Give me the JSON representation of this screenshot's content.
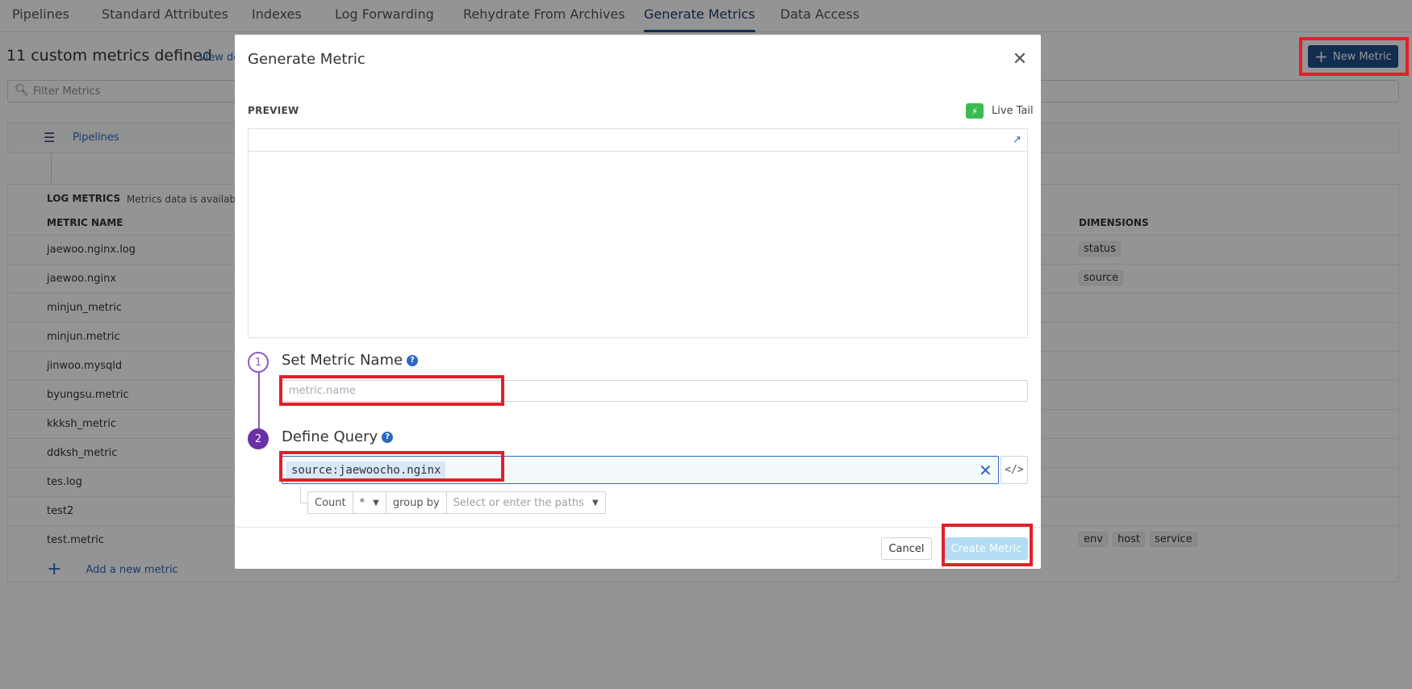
{
  "nav": {
    "tabs": [
      {
        "label": "Pipelines"
      },
      {
        "label": "Standard Attributes"
      },
      {
        "label": "Indexes"
      },
      {
        "label": "Log Forwarding"
      },
      {
        "label": "Rehydrate From Archives"
      },
      {
        "label": "Generate Metrics",
        "active": true
      },
      {
        "label": "Data Access"
      }
    ]
  },
  "page": {
    "count_title": "11 custom metrics defined",
    "view_docs": "View do",
    "new_metric_label": "New Metric",
    "filter_placeholder": "Filter Metrics",
    "pipelines_label": "Pipelines",
    "log_metrics_title": "LOG METRICS",
    "log_metrics_sub": "Metrics data is available f",
    "col_metric_name": "METRIC NAME",
    "col_dimensions": "DIMENSIONS",
    "add_metric_label": "Add a new metric",
    "metrics": [
      {
        "name": "jaewoo.nginx.log",
        "dims": [
          "status"
        ]
      },
      {
        "name": "jaewoo.nginx",
        "dims": [
          "source"
        ]
      },
      {
        "name": "minjun_metric",
        "dims": []
      },
      {
        "name": "minjun.metric",
        "dims": []
      },
      {
        "name": "jinwoo.mysqld",
        "dims": []
      },
      {
        "name": "byungsu.metric",
        "dims": []
      },
      {
        "name": "kkksh_metric",
        "dims": []
      },
      {
        "name": "ddksh_metric",
        "dims": []
      },
      {
        "name": "tes.log",
        "dims": []
      },
      {
        "name": "test2",
        "dims": []
      },
      {
        "name": "test.metric",
        "dims": [
          "env",
          "host",
          "service"
        ]
      }
    ]
  },
  "modal": {
    "title": "Generate Metric",
    "preview_label": "PREVIEW",
    "live_tail_label": "Live Tail",
    "step1": {
      "number": "1",
      "title": "Set Metric Name",
      "placeholder": "metric.name",
      "value": ""
    },
    "step2": {
      "number": "2",
      "title": "Define Query",
      "query": "source:jaewoocho.nginx"
    },
    "aggregation": {
      "count_label": "Count",
      "measure": "*",
      "group_by_label": "group by",
      "paths_placeholder": "Select or enter the paths"
    },
    "cancel_label": "Cancel",
    "create_label": "Create Metric"
  },
  "colors": {
    "accent": "#1e4f8a",
    "link": "#2b68c1",
    "step": "#6b2fa6",
    "highlight": "#e0202a",
    "live_tail": "#3cba54",
    "create_disabled": "#b3dcf5"
  },
  "icons": {
    "close": "close-icon",
    "bolt": "lightning-bolt-icon",
    "external": "external-link-icon",
    "help": "help-icon",
    "clear": "clear-x-icon",
    "code": "code-icon",
    "search": "search-icon",
    "plus": "plus-icon"
  }
}
